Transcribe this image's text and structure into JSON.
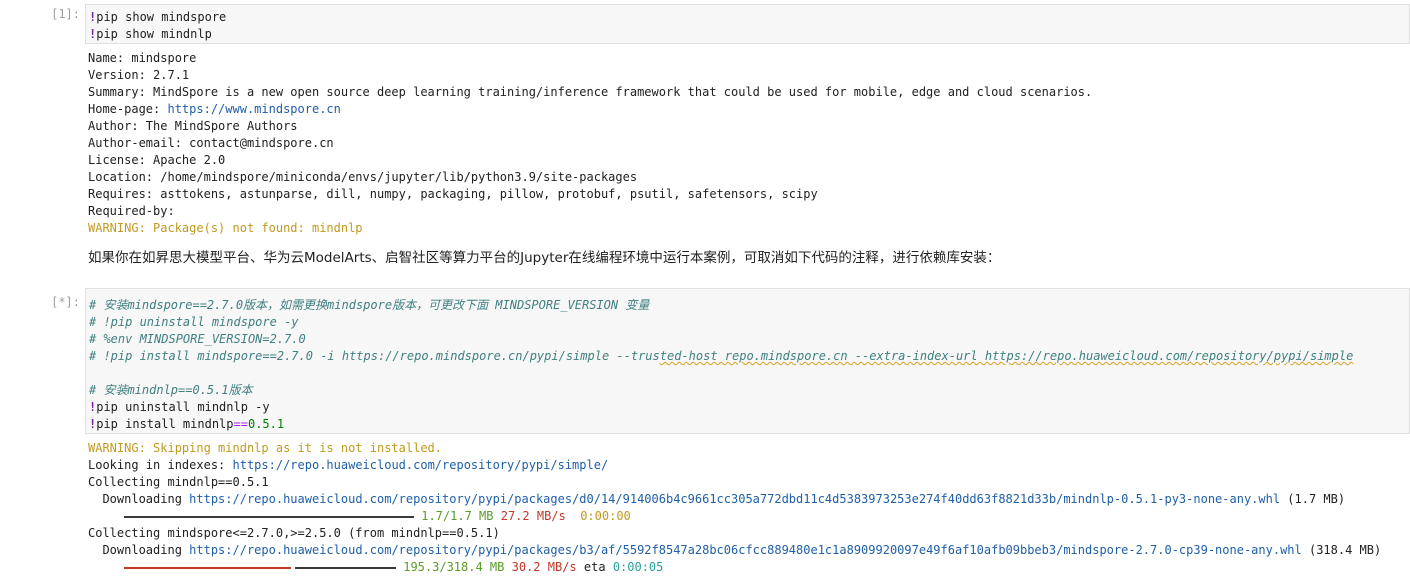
{
  "cell1": {
    "prompt": "[1]:",
    "lines": [
      {
        "bang": "!",
        "text": "pip show mindspore"
      },
      {
        "bang": "!",
        "text": "pip show mindnlp"
      }
    ],
    "output": {
      "name": "Name: mindspore",
      "version": "Version: 2.7.1",
      "summary": "Summary: MindSpore is a new open source deep learning training/inference framework that could be used for mobile, edge and cloud scenarios.",
      "homepage_label": "Home-page: ",
      "homepage_url": "https://www.mindspore.cn",
      "author": "Author: The MindSpore Authors",
      "author_email": "Author-email: contact@mindspore.cn",
      "license": "License: Apache 2.0",
      "location": "Location: /home/mindspore/miniconda/envs/jupyter/lib/python3.9/site-packages",
      "requires": "Requires: asttokens, astunparse, dill, numpy, packaging, pillow, protobuf, psutil, safetensors, scipy",
      "required_by": "Required-by: ",
      "warning": "WARNING: Package(s) not found: mindnlp"
    }
  },
  "markdown": {
    "text": "如果你在如昇思大模型平台、华为云ModelArts、启智社区等算力平台的Jupyter在线编程环境中运行本案例，可取消如下代码的注释，进行依赖库安装："
  },
  "cell2": {
    "prompt": "[*]:",
    "comment1": "# 安装mindspore==2.7.0版本，如需更换mindspore版本，可更改下面 MINDSPORE_VERSION 变量",
    "comment2": "# !pip uninstall mindspore -y",
    "comment3": "# %env MINDSPORE_VERSION=2.7.0",
    "comment4_a": "# !pip install mindspore==2.7.0 -i https://repo.mindspore.cn/pypi/simple --trus",
    "comment4_b": "ted-host repo.mindspore.cn --extra-index-url https://repo.huaweicloud.com/repository/pypi/simple",
    "comment5": "# 安装mindnlp==0.5.1版本",
    "uninstall": "pip uninstall mindnlp -y",
    "install_prefix": "pip install mindnlp",
    "install_op": "==",
    "install_version": "0.5.1",
    "output": {
      "warning": "WARNING: Skipping mindnlp as it is not installed.",
      "looking_label": "Looking in indexes: ",
      "looking_url": "https://repo.huaweicloud.com/repository/pypi/simple/",
      "collect1": "Collecting mindnlp==0.5.1",
      "dl1_label": "  Downloading ",
      "dl1_url": "https://repo.huaweicloud.com/repository/pypi/packages/d0/14/914006b4c9661cc305a772dbd11c4d5383973253e274f40dd63f8821d33b/mindnlp-0.5.1-py3-none-any.whl",
      "dl1_size": " (1.7 MB)",
      "prog1_size": "1.7/1.7 MB",
      "prog1_speed": "27.2 MB/s",
      "prog1_eta": "0:00:00",
      "prog1_fraction": 1.0,
      "collect2": "Collecting mindspore<=2.7.0,>=2.5.0 (from mindnlp==0.5.1)",
      "dl2_label": "  Downloading ",
      "dl2_url": "https://repo.huaweicloud.com/repository/pypi/packages/b3/af/5592f8547a28bc06cfcc889480e1c1a8909920097e49f6af10afb09bbeb3/mindspore-2.7.0-cp39-none-any.whl",
      "dl2_size": " (318.4 MB)",
      "prog2_size": "195.3/318.4 MB",
      "prog2_speed": "30.2 MB/s",
      "prog2_eta_label": "eta",
      "prog2_eta": "0:00:05",
      "prog2_fraction": 0.613
    }
  },
  "colors": {
    "link": "#1f5fa8",
    "warning": "#c09a20",
    "progress_done": "#5a9a2a",
    "progress_active": "#c0392b"
  }
}
